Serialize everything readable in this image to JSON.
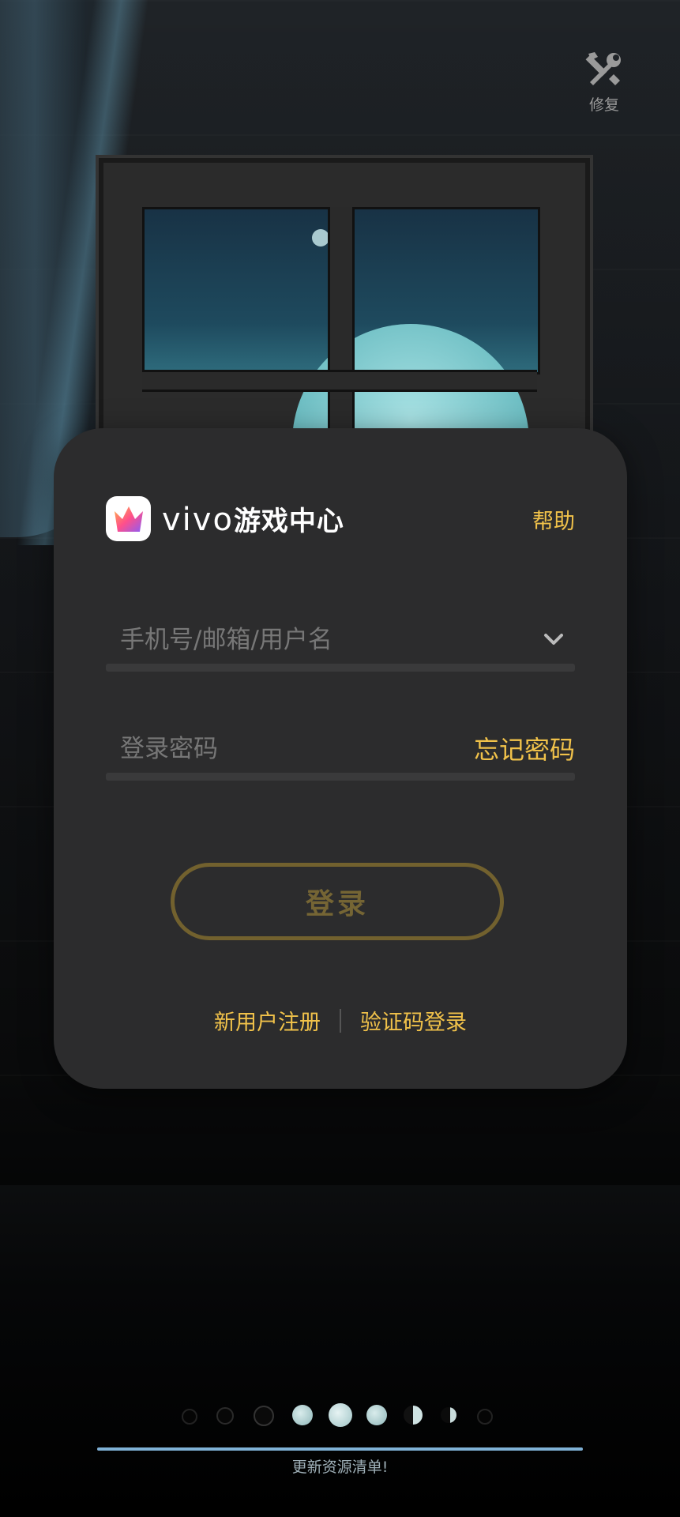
{
  "repair": {
    "icon": "wrench-screwdriver-icon",
    "label": "修复"
  },
  "card": {
    "brand": {
      "logo_icon": "crown-icon",
      "name_latin": "vivo",
      "name_cn": "游戏中心"
    },
    "help_label": "帮助",
    "account_field": {
      "placeholder": "手机号/邮箱/用户名",
      "value": "",
      "dropdown_icon": "chevron-down-icon"
    },
    "password_field": {
      "placeholder": "登录密码",
      "value": "",
      "forgot_label": "忘记密码"
    },
    "login_button_label": "登录",
    "register_label": "新用户注册",
    "sms_login_label": "验证码登录"
  },
  "loading": {
    "status_text": "更新资源清单!",
    "progress": 1.0,
    "moon_phase_count": 9
  },
  "colors": {
    "accent": "#f1c24a",
    "card_bg": "#2c2c2d",
    "disabled_button": "#756534"
  }
}
